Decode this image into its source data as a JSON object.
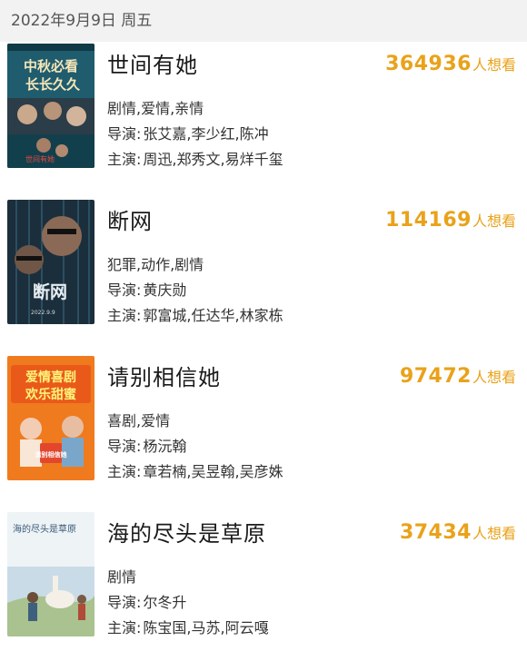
{
  "date_header": "2022年9月9日 周五",
  "want_unit": "人想看",
  "director_label": "导演:",
  "cast_label": "主演:",
  "movies": [
    {
      "title": "世间有她",
      "want_count": "364936",
      "genre": "剧情,爱情,亲情",
      "director": "张艾嘉,李少红,陈冲",
      "cast": "周迅,郑秀文,易烊千玺",
      "poster_text": "中秋必看长长久久",
      "poster_color": "#1f5c6e"
    },
    {
      "title": "断网",
      "want_count": "114169",
      "genre": "犯罪,动作,剧情",
      "director": "黄庆勋",
      "cast": "郭富城,任达华,林家栋",
      "poster_text": "断网",
      "poster_color": "#1b2e3c"
    },
    {
      "title": "请别相信她",
      "want_count": "97472",
      "genre": "喜剧,爱情",
      "director": "杨沅翰",
      "cast": "章若楠,吴昱翰,吴彦姝",
      "poster_text": "爱情喜剧欢乐甜蜜",
      "poster_color": "#f07a1e"
    },
    {
      "title": "海的尽头是草原",
      "want_count": "37434",
      "genre": "剧情",
      "director": "尔冬升",
      "cast": "陈宝国,马苏,阿云嘎",
      "poster_text": "海的尽头是草原",
      "poster_color": "#dfe9ee"
    }
  ]
}
